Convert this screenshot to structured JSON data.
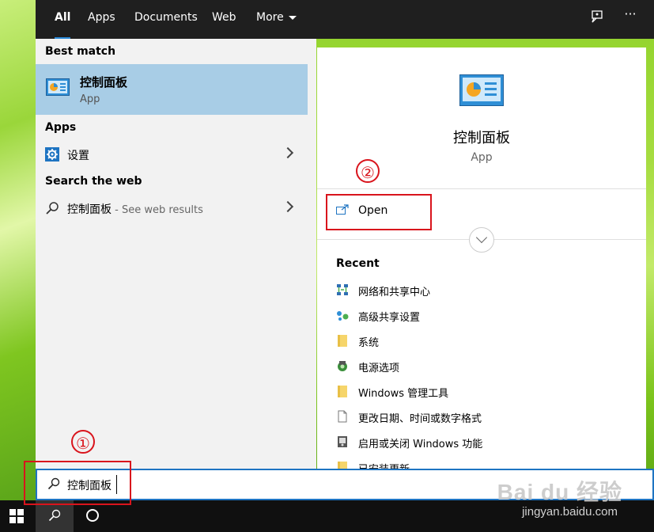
{
  "tabs": [
    {
      "label": "All",
      "active": true
    },
    {
      "label": "Apps"
    },
    {
      "label": "Documents"
    },
    {
      "label": "Web"
    },
    {
      "label": "More"
    }
  ],
  "topbar": {
    "feedback_icon": "feedback-icon",
    "more_icon": "ellipsis-icon",
    "more_glyph": "···"
  },
  "left": {
    "best_match_header": "Best match",
    "best_match": {
      "name": "控制面板",
      "type": "App"
    },
    "apps_header": "Apps",
    "apps": [
      {
        "label": "设置",
        "icon": "settings-gear-icon"
      }
    ],
    "web_header": "Search the web",
    "web": [
      {
        "label": "控制面板",
        "suffix": " - See web results"
      }
    ]
  },
  "right": {
    "title": "控制面板",
    "subtitle": "App",
    "open_label": "Open",
    "recent_header": "Recent",
    "recent": [
      {
        "label": "网络和共享中心",
        "icon": "network-icon"
      },
      {
        "label": "高级共享设置",
        "icon": "sharing-icon"
      },
      {
        "label": "系统",
        "icon": "folder-icon"
      },
      {
        "label": "电源选项",
        "icon": "power-icon"
      },
      {
        "label": "Windows 管理工具",
        "icon": "folder-icon"
      },
      {
        "label": "更改日期、时间或数字格式",
        "icon": "document-icon"
      },
      {
        "label": "启用或关闭 Windows 功能",
        "icon": "features-icon"
      },
      {
        "label": "已安装更新",
        "icon": "folder-icon"
      }
    ]
  },
  "search": {
    "value": "控制面板"
  },
  "annotations": {
    "one": "①",
    "two": "②"
  },
  "watermark": {
    "brand": "Bai du 经验",
    "url": "jingyan.baidu.com"
  },
  "colors": {
    "accent": "#2b8ad9",
    "highlight": "#a8cde6",
    "annotation": "#d9141c"
  }
}
